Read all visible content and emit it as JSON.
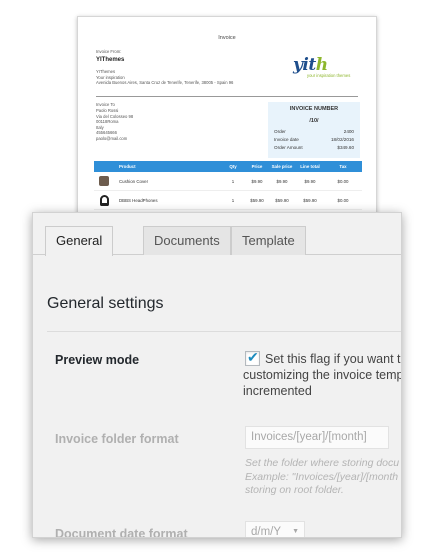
{
  "invoice": {
    "title": "Invoice",
    "from_label": "Invoice From:",
    "company": "YIThemes",
    "company_lines": [
      "YIThemes",
      "Your inspiration",
      "Avenida Buenos Aires, Santa Cruz de Tenerife, Tenerife, 38005 - Spain 96"
    ],
    "logo_text": "yith",
    "logo_tagline": "your inspiration themes",
    "to_label": "Invoice To",
    "to_lines": [
      "Paolo Rossi",
      "Via del Colosseo 98",
      "00118Roma",
      "Italy",
      "455645666",
      "paolo@mail.com"
    ],
    "box": {
      "title": "INVOICE NUMBER",
      "number": "/10/",
      "rows": [
        {
          "label": "Order",
          "value": "2400"
        },
        {
          "label": "Invoice date",
          "value": "18/02/2016"
        },
        {
          "label": "Order Amount",
          "value": "$349.60"
        }
      ]
    },
    "columns": [
      "Product",
      "Qty",
      "Price",
      "Sale price",
      "Line total",
      "Tax"
    ],
    "items": [
      {
        "name": "Cushion Cover",
        "qty": "1",
        "price": "$9.90",
        "sale": "$9.90",
        "total": "$9.90",
        "tax": "$0.00",
        "thumb": "cushion-icon"
      },
      {
        "name": "DBBS HeadPhones",
        "qty": "1",
        "price": "$59.90",
        "sale": "$59.90",
        "total": "$59.90",
        "tax": "$0.00",
        "thumb": "headphones-icon"
      }
    ]
  },
  "settings": {
    "tabs": [
      {
        "label": "General",
        "active": true
      },
      {
        "label": "Documents",
        "active": false
      },
      {
        "label": "Template",
        "active": false
      }
    ],
    "section_title": "General settings",
    "preview": {
      "label": "Preview mode",
      "checked": true,
      "description": "Set this flag if you want to customizing the invoice temp be incremented"
    },
    "folder": {
      "label": "Invoice folder format",
      "value": "Invoices/[year]/[month]",
      "help": "Set the folder where storing docu Example: \"Invoices/[year]/[month for storing on root folder."
    },
    "date": {
      "label": "Document date format",
      "value": "d/m/Y"
    },
    "colors": {
      "accent": "#1e8cbe",
      "table_header": "#2f8fd8",
      "invoice_box": "#e8f3fb"
    }
  }
}
